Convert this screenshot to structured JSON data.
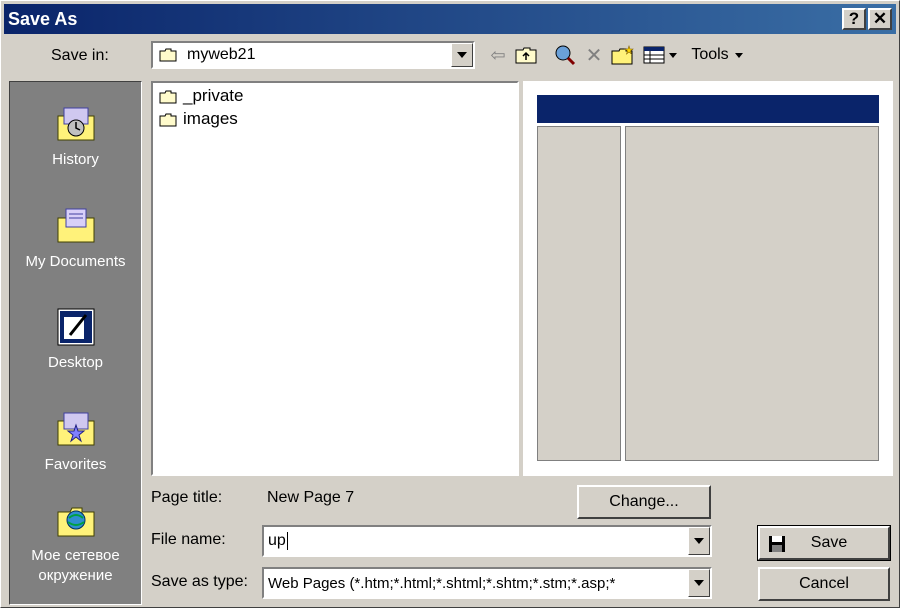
{
  "window": {
    "title": "Save As",
    "help_label": "?",
    "close_label": "✕"
  },
  "toolbar": {
    "save_in_label": "Save in:",
    "save_in_value": "myweb21",
    "tools_label": "Tools"
  },
  "places": [
    {
      "label": "History",
      "icon": "history-icon"
    },
    {
      "label": "My Documents",
      "icon": "my-documents-icon"
    },
    {
      "label": "Desktop",
      "icon": "desktop-icon"
    },
    {
      "label": "Favorites",
      "icon": "favorites-icon"
    },
    {
      "label": "Мое сетевое окружение",
      "icon": "network-places-icon"
    }
  ],
  "files": [
    {
      "name": "_private",
      "icon": "folder-icon"
    },
    {
      "name": "images",
      "icon": "folder-icon"
    }
  ],
  "form": {
    "page_title_label": "Page title:",
    "page_title_value": "New Page 7",
    "change_button": "Change...",
    "file_name_label": "File name:",
    "file_name_value": "up",
    "save_as_type_label": "Save as type:",
    "save_as_type_value": "Web Pages (*.htm;*.html;*.shtml;*.shtm;*.stm;*.asp;*",
    "save_button": "Save",
    "cancel_button": "Cancel"
  },
  "colors": {
    "title_bar": "#0a246a",
    "face": "#d4d0c8",
    "places_bg": "#808080",
    "preview_banner": "#0a246a"
  }
}
